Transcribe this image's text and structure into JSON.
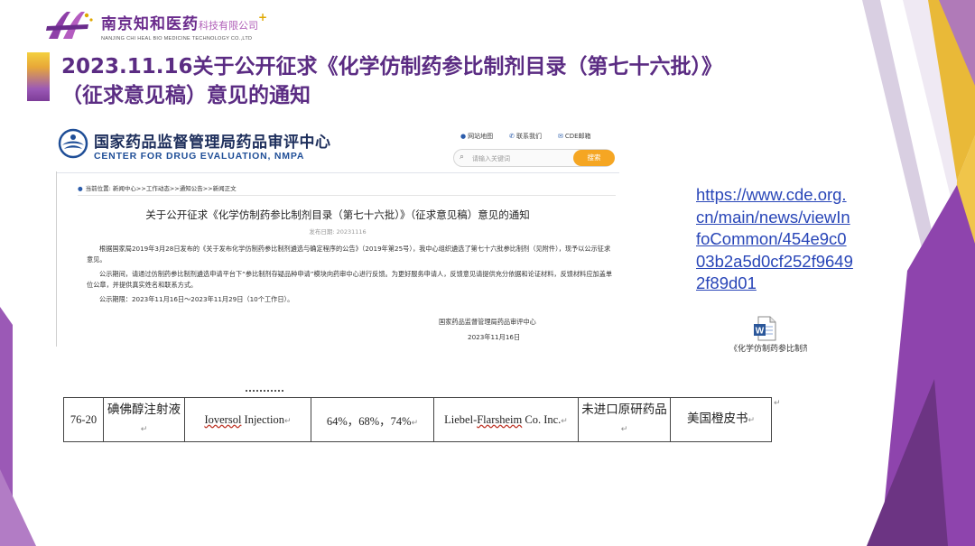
{
  "company": {
    "name_cn": "南京知和医药",
    "name_cn_small": "科技有限公司",
    "plus": "+",
    "name_en": "NANJING CHI HEAL BIO MEDICINE TECHNOLOGY CO.,LTD",
    "brand_color": "#6a2b8c"
  },
  "slide": {
    "title": "2023.11.16关于公开征求《化学仿制药参比制剂目录（第七十六批）》（征求意见稿）意见的通知"
  },
  "cde": {
    "name_cn": "国家药品监督管理局药品审评中心",
    "name_en": "CENTER FOR DRUG EVALUATION, NMPA",
    "links": [
      {
        "label": "网站地图",
        "icon": "map-pin-icon"
      },
      {
        "label": "联系我们",
        "icon": "phone-icon"
      },
      {
        "label": "CDE邮箱",
        "icon": "mail-icon"
      }
    ],
    "search_placeholder": "请输入关键词",
    "search_button": "搜索",
    "breadcrumb": "当前位置: 新闻中心>>工作动态>>通知公告>>新闻正文",
    "notice_title": "关于公开征求《化学仿制药参比制剂目录（第七十六批）》（征求意见稿）意见的通知",
    "publish_date": "发布日期: 20231116",
    "paragraphs": [
      "根据国家局2019年3月28日发布的《关于发布化学仿制药参比制剂遴选与确定程序的公告》（2019年第25号），我中心组织遴选了第七十六批参比制剂（见附件），现予以公示征求意见。",
      "公示期间，请通过仿制药参比制剂遴选申请平台下“参比制剂存疑品种申请”模块向药审中心进行反馈。为更好服务申请人，反馈意见请提供充分依据和论证材料，反馈材料应加盖单位公章，并提供真实姓名和联系方式。",
      "公示期限：2023年11月16日～2023年11月29日（10个工作日）。"
    ],
    "signature": "国家药品监督管理局药品审评中心",
    "sign_date": "2023年11月16日"
  },
  "url": "https://www.cde.org.cn/main/news/viewInfoCommon/454e9c003b2a5d0cf252f96492f89d01",
  "attachment": {
    "label": "《化学仿制药参比制剂目录（第七十六批）》（征",
    "icon": "word-doc-icon"
  },
  "table": {
    "return_mark": "↵",
    "row": {
      "no": "76-20",
      "name_cn": "碘佛醇注射液",
      "name_en_a": "Ioversol",
      "name_en_b": " Injection",
      "spec": "64%，68%，74%",
      "holder_a": "Liebel-",
      "holder_b": "Flarsheim",
      "holder_c": " Co. Inc.",
      "note": "未进口原研药品",
      "source": "美国橙皮书"
    }
  }
}
